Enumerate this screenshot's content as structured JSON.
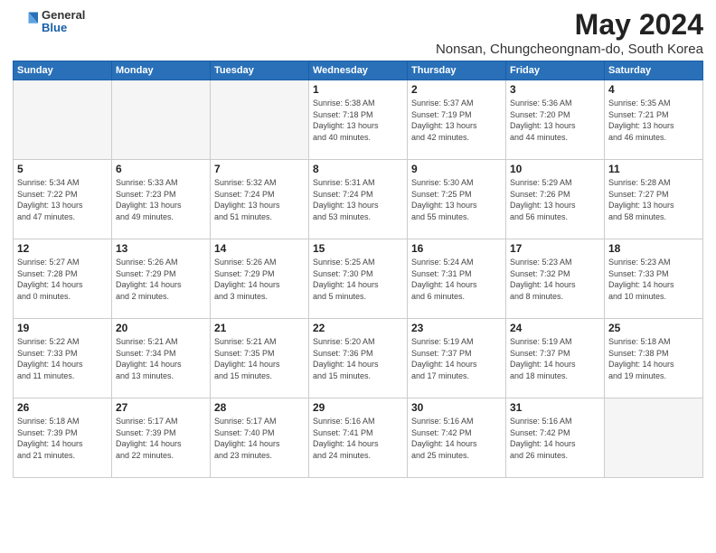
{
  "logo": {
    "general": "General",
    "blue": "Blue"
  },
  "title": "May 2024",
  "subtitle": "Nonsan, Chungcheongnam-do, South Korea",
  "headers": [
    "Sunday",
    "Monday",
    "Tuesday",
    "Wednesday",
    "Thursday",
    "Friday",
    "Saturday"
  ],
  "weeks": [
    [
      {
        "day": "",
        "info": ""
      },
      {
        "day": "",
        "info": ""
      },
      {
        "day": "",
        "info": ""
      },
      {
        "day": "1",
        "info": "Sunrise: 5:38 AM\nSunset: 7:18 PM\nDaylight: 13 hours\nand 40 minutes."
      },
      {
        "day": "2",
        "info": "Sunrise: 5:37 AM\nSunset: 7:19 PM\nDaylight: 13 hours\nand 42 minutes."
      },
      {
        "day": "3",
        "info": "Sunrise: 5:36 AM\nSunset: 7:20 PM\nDaylight: 13 hours\nand 44 minutes."
      },
      {
        "day": "4",
        "info": "Sunrise: 5:35 AM\nSunset: 7:21 PM\nDaylight: 13 hours\nand 46 minutes."
      }
    ],
    [
      {
        "day": "5",
        "info": "Sunrise: 5:34 AM\nSunset: 7:22 PM\nDaylight: 13 hours\nand 47 minutes."
      },
      {
        "day": "6",
        "info": "Sunrise: 5:33 AM\nSunset: 7:23 PM\nDaylight: 13 hours\nand 49 minutes."
      },
      {
        "day": "7",
        "info": "Sunrise: 5:32 AM\nSunset: 7:24 PM\nDaylight: 13 hours\nand 51 minutes."
      },
      {
        "day": "8",
        "info": "Sunrise: 5:31 AM\nSunset: 7:24 PM\nDaylight: 13 hours\nand 53 minutes."
      },
      {
        "day": "9",
        "info": "Sunrise: 5:30 AM\nSunset: 7:25 PM\nDaylight: 13 hours\nand 55 minutes."
      },
      {
        "day": "10",
        "info": "Sunrise: 5:29 AM\nSunset: 7:26 PM\nDaylight: 13 hours\nand 56 minutes."
      },
      {
        "day": "11",
        "info": "Sunrise: 5:28 AM\nSunset: 7:27 PM\nDaylight: 13 hours\nand 58 minutes."
      }
    ],
    [
      {
        "day": "12",
        "info": "Sunrise: 5:27 AM\nSunset: 7:28 PM\nDaylight: 14 hours\nand 0 minutes."
      },
      {
        "day": "13",
        "info": "Sunrise: 5:26 AM\nSunset: 7:29 PM\nDaylight: 14 hours\nand 2 minutes."
      },
      {
        "day": "14",
        "info": "Sunrise: 5:26 AM\nSunset: 7:29 PM\nDaylight: 14 hours\nand 3 minutes."
      },
      {
        "day": "15",
        "info": "Sunrise: 5:25 AM\nSunset: 7:30 PM\nDaylight: 14 hours\nand 5 minutes."
      },
      {
        "day": "16",
        "info": "Sunrise: 5:24 AM\nSunset: 7:31 PM\nDaylight: 14 hours\nand 6 minutes."
      },
      {
        "day": "17",
        "info": "Sunrise: 5:23 AM\nSunset: 7:32 PM\nDaylight: 14 hours\nand 8 minutes."
      },
      {
        "day": "18",
        "info": "Sunrise: 5:23 AM\nSunset: 7:33 PM\nDaylight: 14 hours\nand 10 minutes."
      }
    ],
    [
      {
        "day": "19",
        "info": "Sunrise: 5:22 AM\nSunset: 7:33 PM\nDaylight: 14 hours\nand 11 minutes."
      },
      {
        "day": "20",
        "info": "Sunrise: 5:21 AM\nSunset: 7:34 PM\nDaylight: 14 hours\nand 13 minutes."
      },
      {
        "day": "21",
        "info": "Sunrise: 5:21 AM\nSunset: 7:35 PM\nDaylight: 14 hours\nand 15 minutes."
      },
      {
        "day": "22",
        "info": "Sunrise: 5:20 AM\nSunset: 7:36 PM\nDaylight: 14 hours\nand 15 minutes."
      },
      {
        "day": "23",
        "info": "Sunrise: 5:19 AM\nSunset: 7:37 PM\nDaylight: 14 hours\nand 17 minutes."
      },
      {
        "day": "24",
        "info": "Sunrise: 5:19 AM\nSunset: 7:37 PM\nDaylight: 14 hours\nand 18 minutes."
      },
      {
        "day": "25",
        "info": "Sunrise: 5:18 AM\nSunset: 7:38 PM\nDaylight: 14 hours\nand 19 minutes."
      }
    ],
    [
      {
        "day": "26",
        "info": "Sunrise: 5:18 AM\nSunset: 7:39 PM\nDaylight: 14 hours\nand 21 minutes."
      },
      {
        "day": "27",
        "info": "Sunrise: 5:17 AM\nSunset: 7:39 PM\nDaylight: 14 hours\nand 22 minutes."
      },
      {
        "day": "28",
        "info": "Sunrise: 5:17 AM\nSunset: 7:40 PM\nDaylight: 14 hours\nand 23 minutes."
      },
      {
        "day": "29",
        "info": "Sunrise: 5:16 AM\nSunset: 7:41 PM\nDaylight: 14 hours\nand 24 minutes."
      },
      {
        "day": "30",
        "info": "Sunrise: 5:16 AM\nSunset: 7:42 PM\nDaylight: 14 hours\nand 25 minutes."
      },
      {
        "day": "31",
        "info": "Sunrise: 5:16 AM\nSunset: 7:42 PM\nDaylight: 14 hours\nand 26 minutes."
      },
      {
        "day": "",
        "info": ""
      }
    ]
  ]
}
